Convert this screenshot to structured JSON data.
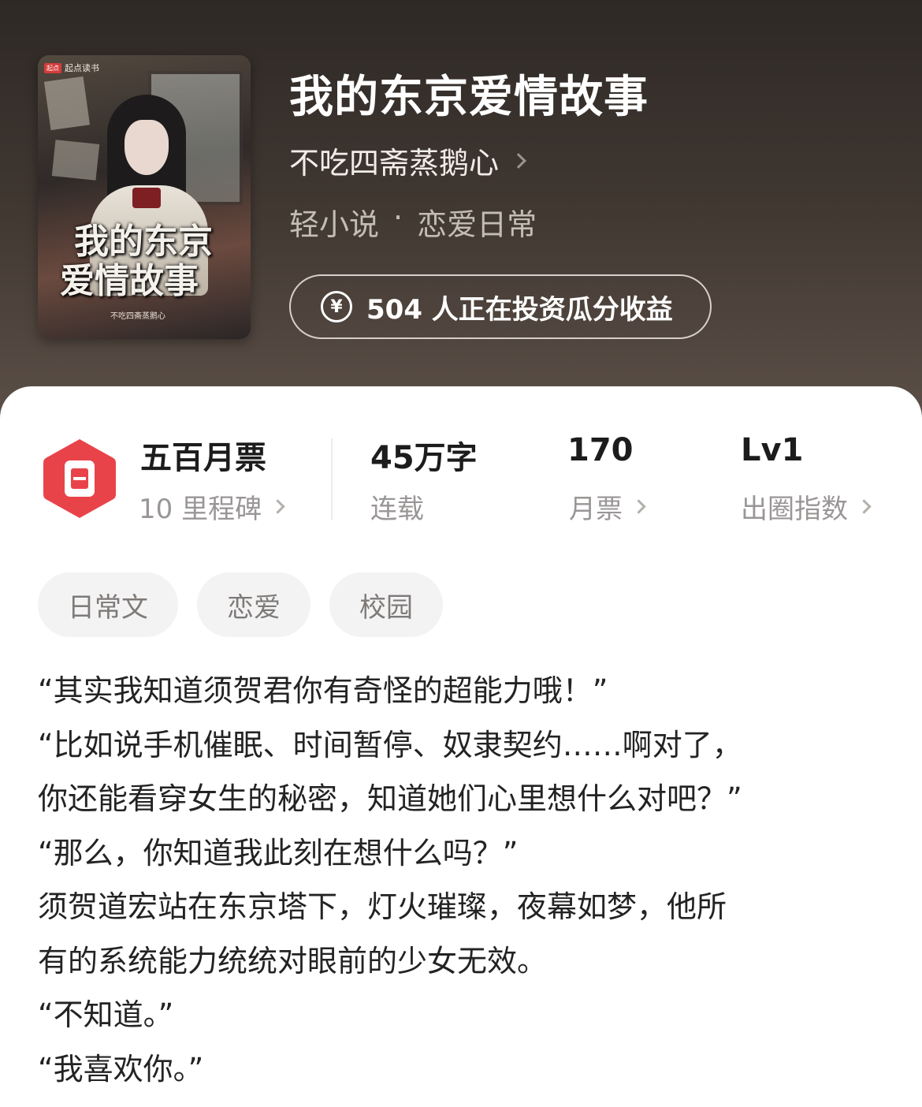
{
  "book": {
    "title": "我的东京爱情故事",
    "author": "不吃四斋蒸鹅心",
    "genre_main": "轻小说",
    "genre_sep": "·",
    "genre_sub": "恋爱日常",
    "invest_text": "504 人正在投资瓜分收益",
    "invest_icon": "¥"
  },
  "cover": {
    "publisher_badge": "起点",
    "publisher": "起点读书",
    "title_line1": "我的东京",
    "title_line2": "爱情故事",
    "author": "不吃四斋蒸鹅心"
  },
  "stats": {
    "milestone": {
      "title": "五百月票",
      "sub": "10 里程碑"
    },
    "words": {
      "title": "45万字",
      "sub": "连载"
    },
    "votes": {
      "title": "170",
      "sub": "月票"
    },
    "level": {
      "title": "Lv1",
      "sub": "出圈指数"
    }
  },
  "tags": [
    "日常文",
    "恋爱",
    "校园"
  ],
  "synopsis": [
    "“其实我知道须贺君你有奇怪的超能力哦！”",
    "“比如说手机催眠、时间暂停、奴隶契约……啊对了，",
    "你还能看穿女生的秘密，知道她们心里想什么对吧？”",
    "“那么，你知道我此刻在想什么吗？”",
    "须贺道宏站在东京塔下，灯火璀璨，夜幕如梦，他所",
    "有的系统能力统统对眼前的少女无效。",
    "“不知道。”",
    "“我喜欢你。”"
  ],
  "colors": {
    "header_bg": "#3f3630",
    "badge_red": "#e9434a",
    "tag_bg": "#f4f3f3"
  }
}
